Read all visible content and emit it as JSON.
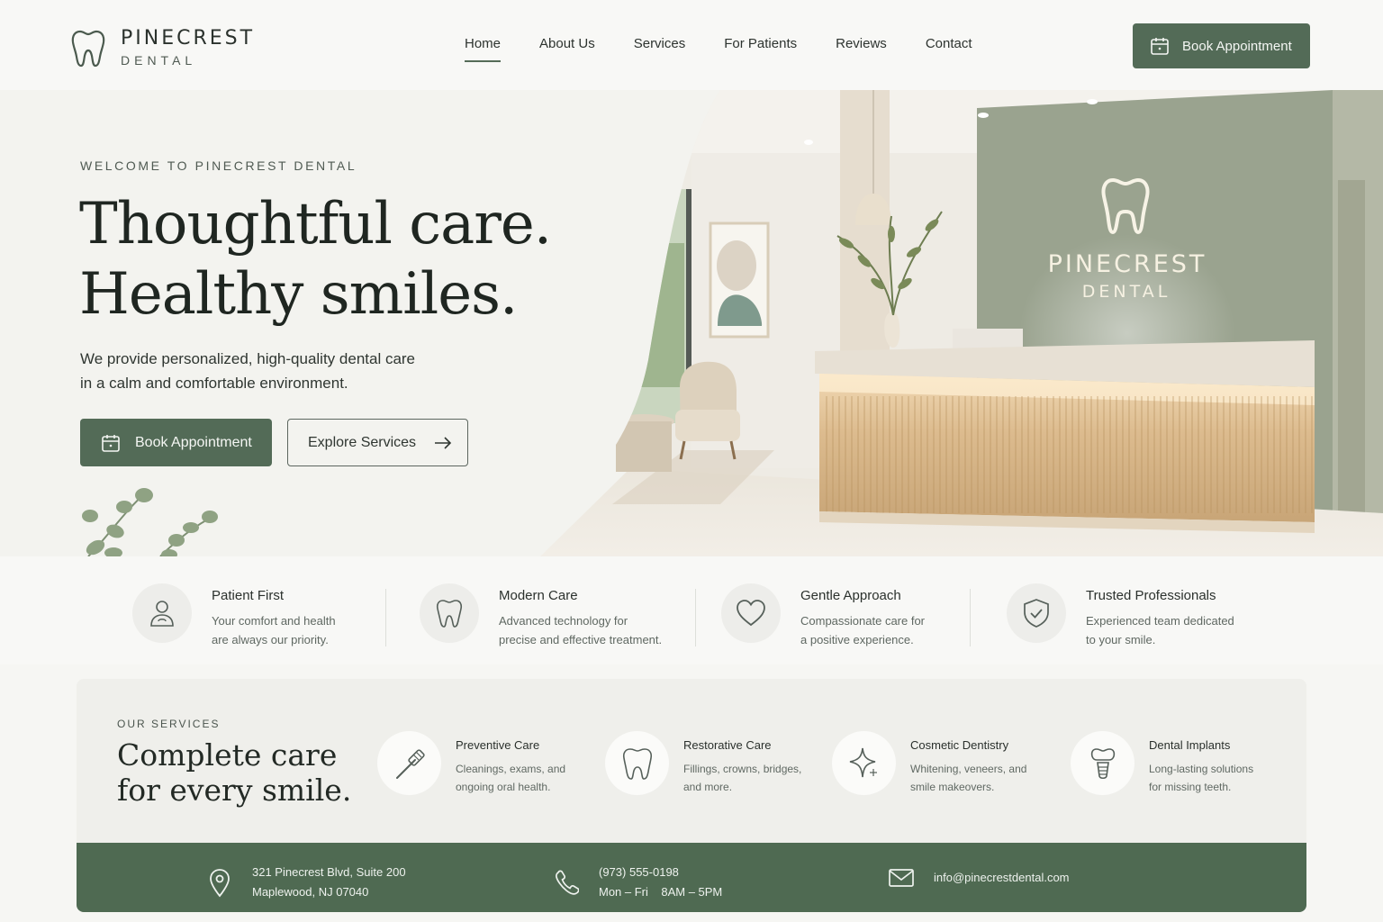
{
  "brand": {
    "name": "PINECREST",
    "sub": "DENTAL",
    "logo_icon": "tooth-icon"
  },
  "nav": {
    "items": [
      {
        "label": "Home",
        "active": true
      },
      {
        "label": "About Us"
      },
      {
        "label": "Services"
      },
      {
        "label": "For Patients"
      },
      {
        "label": "Reviews"
      },
      {
        "label": "Contact"
      }
    ],
    "cta": "Book Appointment"
  },
  "hero": {
    "eyebrow": "WELCOME TO PINECREST DENTAL",
    "headline_line1": "Thoughtful care.",
    "headline_line2": "Healthy smiles.",
    "description_line1": "We provide personalized, high-quality dental care",
    "description_line2": "in a calm and comfortable environment.",
    "primary_button": "Book Appointment",
    "secondary_button": "Explore Services",
    "wall_sign_name": "PINECREST",
    "wall_sign_sub": "DENTAL"
  },
  "features": [
    {
      "icon": "patient-icon",
      "title": "Patient First",
      "line1": "Your comfort and health",
      "line2": "are always our priority."
    },
    {
      "icon": "tooth-icon",
      "title": "Modern Care",
      "line1": "Advanced technology for",
      "line2": "precise and effective treatment."
    },
    {
      "icon": "heart-icon",
      "title": "Gentle Approach",
      "line1": "Compassionate care for",
      "line2": "a positive experience."
    },
    {
      "icon": "shield-check-icon",
      "title": "Trusted Professionals",
      "line1": "Experienced team dedicated",
      "line2": "to your smile."
    }
  ],
  "services": {
    "eyebrow": "OUR SERVICES",
    "heading_line1": "Complete care",
    "heading_line2": "for every smile.",
    "items": [
      {
        "icon": "toothbrush-icon",
        "title": "Preventive Care",
        "line1": "Cleanings, exams, and",
        "line2": "ongoing oral health."
      },
      {
        "icon": "tooth-icon",
        "title": "Restorative Care",
        "line1": "Fillings, crowns, bridges,",
        "line2": "and more."
      },
      {
        "icon": "sparkle-icon",
        "title": "Cosmetic Dentistry",
        "line1": "Whitening, veneers, and",
        "line2": "smile makeovers."
      },
      {
        "icon": "implant-icon",
        "title": "Dental Implants",
        "line1": "Long-lasting solutions",
        "line2": "for missing teeth."
      }
    ]
  },
  "contact": {
    "address_line1": "321 Pinecrest Blvd, Suite 200",
    "address_line2": "Maplewood, NJ 07040",
    "phone": "(973) 555-0198",
    "hours": "Mon – Fri    8AM – 5PM",
    "email": "info@pinecrestdental.com"
  },
  "colors": {
    "accent": "#536b57",
    "contact_bar": "#4f6a52",
    "sage_wall": "#9aa38f"
  }
}
